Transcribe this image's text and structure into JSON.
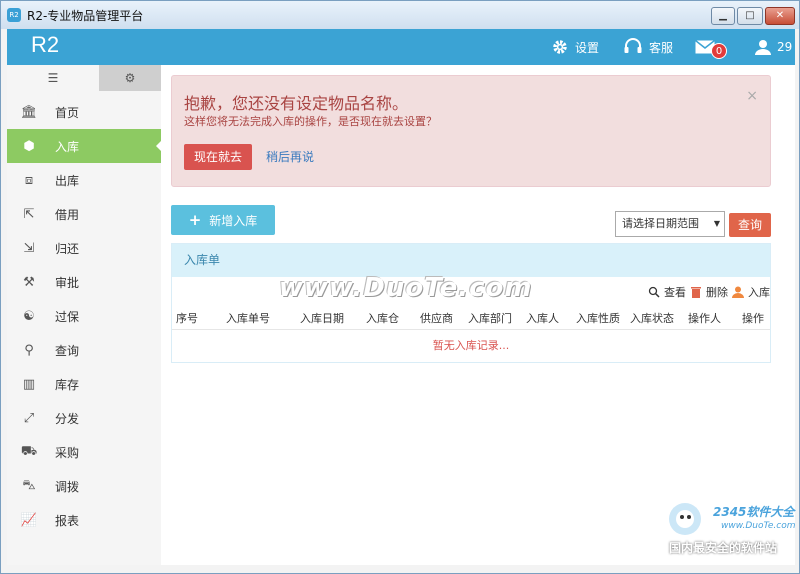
{
  "window": {
    "title": "R2-专业物品管理平台",
    "app_icon": "R2"
  },
  "header": {
    "logo": "R2",
    "settings_label": "设置",
    "service_label": "客服",
    "messages_badge": "0",
    "user_label": "29"
  },
  "sidebar": {
    "items": [
      {
        "label": "首页",
        "icon": "bank-icon"
      },
      {
        "label": "入库",
        "icon": "box-icon"
      },
      {
        "label": "出库",
        "icon": "open-box-icon"
      },
      {
        "label": "借用",
        "icon": "export-icon"
      },
      {
        "label": "归还",
        "icon": "import-icon"
      },
      {
        "label": "审批",
        "icon": "gavel-icon"
      },
      {
        "label": "过保",
        "icon": "yin-yang-icon"
      },
      {
        "label": "查询",
        "icon": "search-icon"
      },
      {
        "label": "库存",
        "icon": "barcode-icon"
      },
      {
        "label": "分发",
        "icon": "expand-icon"
      },
      {
        "label": "采购",
        "icon": "cart-icon"
      },
      {
        "label": "调拨",
        "icon": "truck-icon"
      },
      {
        "label": "报表",
        "icon": "line-chart-icon"
      }
    ]
  },
  "alert": {
    "heading": "抱歉，您还没有设定物品名称。",
    "text": "这样您将无法完成入库的操作，是否现在就去设置？",
    "go_label": "现在就去",
    "later_label": "稍后再说",
    "close": "×"
  },
  "actions": {
    "add_label": "新增入库",
    "date_range_placeholder": "请选择日期范围",
    "query_label": "查询"
  },
  "panel": {
    "title": "入库单",
    "toolbar": {
      "view": "查看",
      "delete": "删除",
      "stock_in": "入库"
    },
    "columns": [
      "序号",
      "入库单号",
      "入库日期",
      "入库仓",
      "供应商",
      "入库部门",
      "入库人",
      "入库性质",
      "入库状态",
      "操作人",
      "操作"
    ],
    "empty_text": "暂无入库记录..."
  },
  "watermarks": {
    "duote": "www.DuoTe.com",
    "brand": "2345软件大全",
    "brand_url": "www.DuoTe.com",
    "slogan": "国内最安全的软件站"
  },
  "colors": {
    "header": "#3ba3d4",
    "active_nav": "#8dca62",
    "danger": "#d9534f",
    "info": "#5bc0de"
  }
}
